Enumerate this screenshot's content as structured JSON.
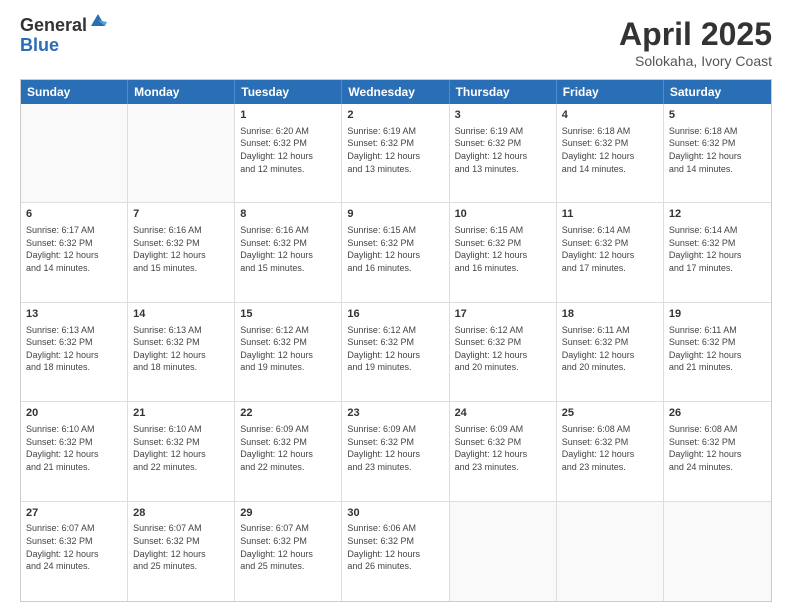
{
  "logo": {
    "general": "General",
    "blue": "Blue"
  },
  "header": {
    "month": "April 2025",
    "location": "Solokaha, Ivory Coast"
  },
  "weekdays": [
    "Sunday",
    "Monday",
    "Tuesday",
    "Wednesday",
    "Thursday",
    "Friday",
    "Saturday"
  ],
  "weeks": [
    [
      {
        "day": "",
        "info": ""
      },
      {
        "day": "",
        "info": ""
      },
      {
        "day": "1",
        "info": "Sunrise: 6:20 AM\nSunset: 6:32 PM\nDaylight: 12 hours\nand 12 minutes."
      },
      {
        "day": "2",
        "info": "Sunrise: 6:19 AM\nSunset: 6:32 PM\nDaylight: 12 hours\nand 13 minutes."
      },
      {
        "day": "3",
        "info": "Sunrise: 6:19 AM\nSunset: 6:32 PM\nDaylight: 12 hours\nand 13 minutes."
      },
      {
        "day": "4",
        "info": "Sunrise: 6:18 AM\nSunset: 6:32 PM\nDaylight: 12 hours\nand 14 minutes."
      },
      {
        "day": "5",
        "info": "Sunrise: 6:18 AM\nSunset: 6:32 PM\nDaylight: 12 hours\nand 14 minutes."
      }
    ],
    [
      {
        "day": "6",
        "info": "Sunrise: 6:17 AM\nSunset: 6:32 PM\nDaylight: 12 hours\nand 14 minutes."
      },
      {
        "day": "7",
        "info": "Sunrise: 6:16 AM\nSunset: 6:32 PM\nDaylight: 12 hours\nand 15 minutes."
      },
      {
        "day": "8",
        "info": "Sunrise: 6:16 AM\nSunset: 6:32 PM\nDaylight: 12 hours\nand 15 minutes."
      },
      {
        "day": "9",
        "info": "Sunrise: 6:15 AM\nSunset: 6:32 PM\nDaylight: 12 hours\nand 16 minutes."
      },
      {
        "day": "10",
        "info": "Sunrise: 6:15 AM\nSunset: 6:32 PM\nDaylight: 12 hours\nand 16 minutes."
      },
      {
        "day": "11",
        "info": "Sunrise: 6:14 AM\nSunset: 6:32 PM\nDaylight: 12 hours\nand 17 minutes."
      },
      {
        "day": "12",
        "info": "Sunrise: 6:14 AM\nSunset: 6:32 PM\nDaylight: 12 hours\nand 17 minutes."
      }
    ],
    [
      {
        "day": "13",
        "info": "Sunrise: 6:13 AM\nSunset: 6:32 PM\nDaylight: 12 hours\nand 18 minutes."
      },
      {
        "day": "14",
        "info": "Sunrise: 6:13 AM\nSunset: 6:32 PM\nDaylight: 12 hours\nand 18 minutes."
      },
      {
        "day": "15",
        "info": "Sunrise: 6:12 AM\nSunset: 6:32 PM\nDaylight: 12 hours\nand 19 minutes."
      },
      {
        "day": "16",
        "info": "Sunrise: 6:12 AM\nSunset: 6:32 PM\nDaylight: 12 hours\nand 19 minutes."
      },
      {
        "day": "17",
        "info": "Sunrise: 6:12 AM\nSunset: 6:32 PM\nDaylight: 12 hours\nand 20 minutes."
      },
      {
        "day": "18",
        "info": "Sunrise: 6:11 AM\nSunset: 6:32 PM\nDaylight: 12 hours\nand 20 minutes."
      },
      {
        "day": "19",
        "info": "Sunrise: 6:11 AM\nSunset: 6:32 PM\nDaylight: 12 hours\nand 21 minutes."
      }
    ],
    [
      {
        "day": "20",
        "info": "Sunrise: 6:10 AM\nSunset: 6:32 PM\nDaylight: 12 hours\nand 21 minutes."
      },
      {
        "day": "21",
        "info": "Sunrise: 6:10 AM\nSunset: 6:32 PM\nDaylight: 12 hours\nand 22 minutes."
      },
      {
        "day": "22",
        "info": "Sunrise: 6:09 AM\nSunset: 6:32 PM\nDaylight: 12 hours\nand 22 minutes."
      },
      {
        "day": "23",
        "info": "Sunrise: 6:09 AM\nSunset: 6:32 PM\nDaylight: 12 hours\nand 23 minutes."
      },
      {
        "day": "24",
        "info": "Sunrise: 6:09 AM\nSunset: 6:32 PM\nDaylight: 12 hours\nand 23 minutes."
      },
      {
        "day": "25",
        "info": "Sunrise: 6:08 AM\nSunset: 6:32 PM\nDaylight: 12 hours\nand 23 minutes."
      },
      {
        "day": "26",
        "info": "Sunrise: 6:08 AM\nSunset: 6:32 PM\nDaylight: 12 hours\nand 24 minutes."
      }
    ],
    [
      {
        "day": "27",
        "info": "Sunrise: 6:07 AM\nSunset: 6:32 PM\nDaylight: 12 hours\nand 24 minutes."
      },
      {
        "day": "28",
        "info": "Sunrise: 6:07 AM\nSunset: 6:32 PM\nDaylight: 12 hours\nand 25 minutes."
      },
      {
        "day": "29",
        "info": "Sunrise: 6:07 AM\nSunset: 6:32 PM\nDaylight: 12 hours\nand 25 minutes."
      },
      {
        "day": "30",
        "info": "Sunrise: 6:06 AM\nSunset: 6:32 PM\nDaylight: 12 hours\nand 26 minutes."
      },
      {
        "day": "",
        "info": ""
      },
      {
        "day": "",
        "info": ""
      },
      {
        "day": "",
        "info": ""
      }
    ]
  ]
}
